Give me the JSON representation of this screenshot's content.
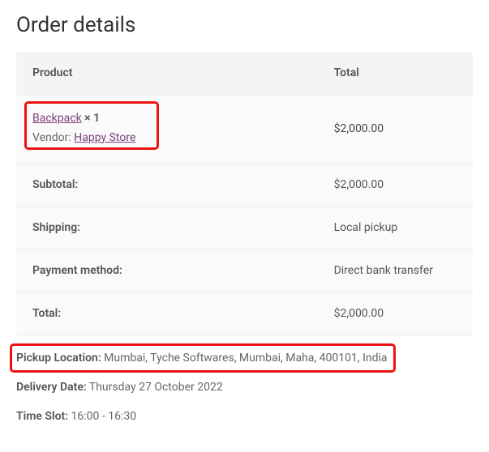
{
  "page": {
    "title": "Order details"
  },
  "headers": {
    "product": "Product",
    "total": "Total"
  },
  "line_item": {
    "product_name": "Backpack",
    "qty_sep": " × ",
    "qty": "1",
    "vendor_label": "Vendor: ",
    "vendor_name": "Happy Store",
    "total": "$2,000.00"
  },
  "totals": {
    "subtotal_label": "Subtotal:",
    "subtotal_value": "$2,000.00",
    "shipping_label": "Shipping:",
    "shipping_value": "Local pickup",
    "payment_label": "Payment method:",
    "payment_value": "Direct bank transfer",
    "total_label": "Total:",
    "total_value": "$2,000.00"
  },
  "meta": {
    "pickup_label": "Pickup Location:",
    "pickup_value": " Mumbai, Tyche Softwares, Mumbai, Maha, 400101, India",
    "delivery_label": "Delivery Date:",
    "delivery_value": " Thursday 27 October 2022",
    "timeslot_label": "Time Slot:",
    "timeslot_value": " 16:00 - 16:30"
  }
}
